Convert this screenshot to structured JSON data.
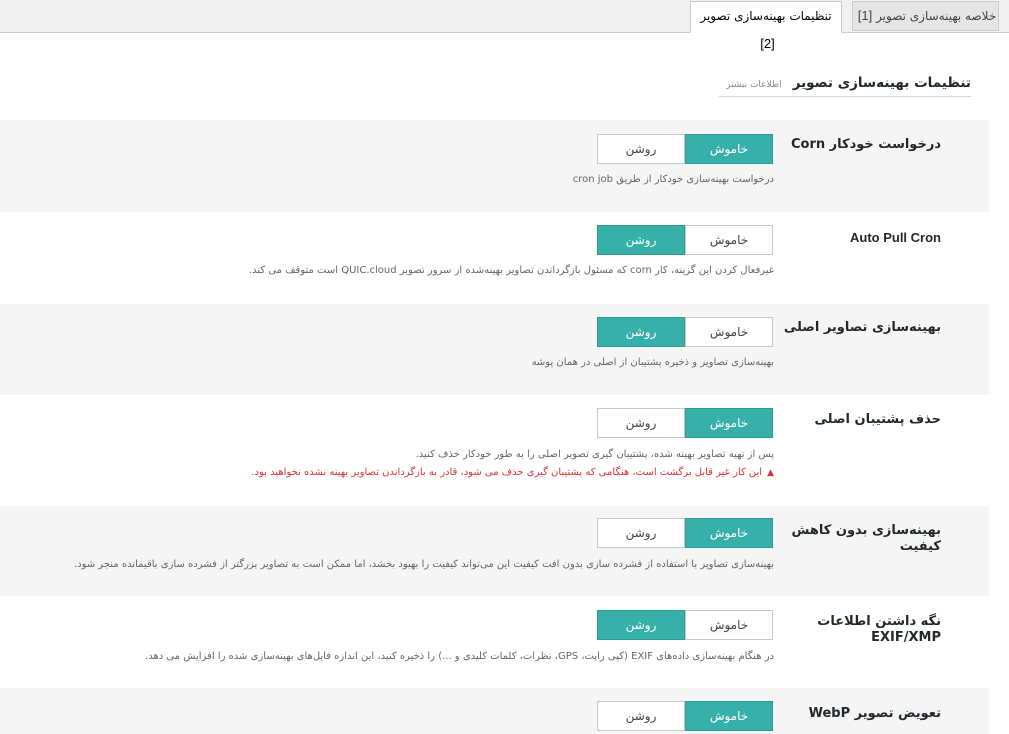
{
  "tabs": [
    {
      "num": "[1]",
      "label": "خلاصه بهینه‌سازی تصویر",
      "active": false
    },
    {
      "num": "[2]",
      "label": "تنظیمات بهینه‌سازی تصویر",
      "active": true
    }
  ],
  "section": {
    "title": "تنظیمات بهینه‌سازی تصویر",
    "learn_more": "اطلاعات بیشتر"
  },
  "toggle_labels": {
    "off": "خاموش",
    "on": "روشن"
  },
  "settings": [
    {
      "label": "درخواست خودکار Corn",
      "value": "off",
      "desc": "درخواست بهینه‌سازی خودکار از طریق cron job"
    },
    {
      "label": "Auto Pull Cron",
      "value": "on",
      "desc": "غیرفعال کردن این گزینه، کار corn که مسئول بازگرداندن تصاویر بهینه‌شده از سرور تصویر QUIC.cloud است متوقف می کند."
    },
    {
      "label": "بهینه‌سازی تصاویر اصلی",
      "value": "on",
      "desc": "بهینه‌سازی تصاویر و ذخیره پشتیبان از اصلی در همان پوشه"
    },
    {
      "label": "حذف پشتیبان اصلی",
      "value": "off",
      "desc": "پس از تهیه تصاویر بهینه شده، پشتیبان گیری تصویر اصلی را به طور خودکار حذف کنید.",
      "warning": "این کار غیر قابل برگشت است، هنگامی که پشتیبان گیری حذف می شود، قادر به بازگرداندن تصاویر بهینه نشده نخواهید بود."
    },
    {
      "label": "بهینه‌سازی بدون کاهش کیفیت",
      "value": "off",
      "desc": "بهینه‌سازی تصاویر با استفاده از فشرده سازی بدون افت کیفیت این می‌تواند کیفیت را بهبود بخشد، اما ممکن است به تصاویر بزرگتر از فشرده سازی باقیمانده منجر شود."
    },
    {
      "label": "نگه داشتن اطلاعات EXIF/XMP",
      "value": "on",
      "desc": "در هنگام بهینه‌سازی داده‌های EXIF (کپی رایت، GPS، نظرات، کلمات کلیدی و ...) را ذخیره کنید، این اندازه فایل‌های بهینه‌سازی شده را افزایش می دهد."
    },
    {
      "label": "تعویض تصویر WebP",
      "value": "off",
      "desc": ""
    }
  ],
  "colors": {
    "accent": "#36b0a8",
    "warning": "#d63638",
    "row_shade": "#f5f5f5"
  },
  "icons": {
    "warning": "warning-icon"
  }
}
